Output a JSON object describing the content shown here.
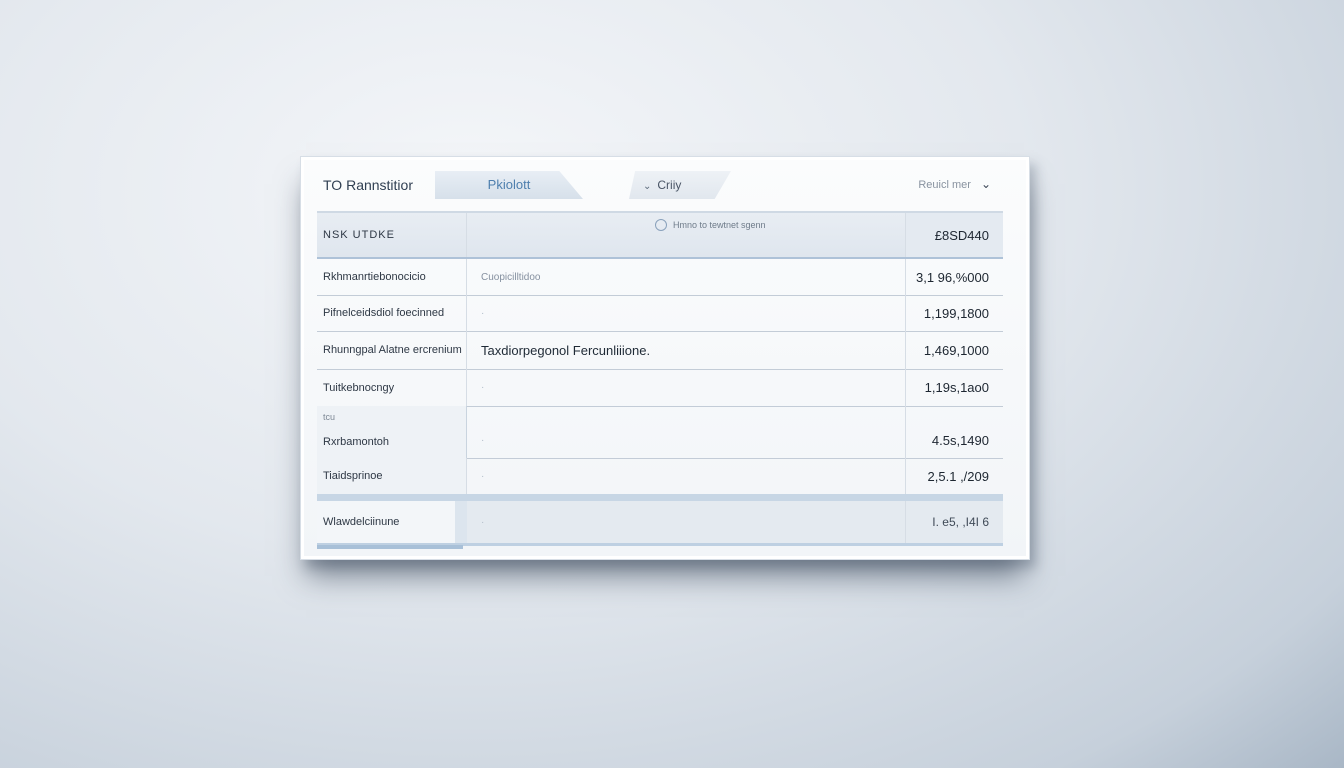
{
  "topbar": {
    "app_title": "TO Rannstitior",
    "tab_active": "Pkiolott",
    "filter_label": "Criiy",
    "report_select": "Reuicl mer"
  },
  "table": {
    "header": {
      "col1": "NSK UTDKE",
      "col2": "Hmno to tewtnet sgenn",
      "col3": "£8SD440"
    },
    "rows": [
      {
        "name": "Rkhmanrtiebonocicio",
        "detail": "Cuopicilltidoo",
        "value": "3,1 96,%000"
      },
      {
        "name": "Pifnelceidsdiol foecinned",
        "detail": "",
        "value": "1,199,1800"
      },
      {
        "name": "Rhunngpal Alatne ercrenium",
        "detail": "Taxdiorpegonol Fercunliiione.",
        "value": "1,469,1000"
      },
      {
        "name": "Tuitkebnocngy",
        "detail": "",
        "value": "1,19s,1ao0"
      },
      {
        "name": "Rxrbamontoh",
        "mini": "tcu",
        "detail": "",
        "value": "4.5s,1490"
      },
      {
        "name": "Tiaidsprinoe",
        "detail": "",
        "value": "2,5.1 ,/209"
      },
      {
        "name": "Wlawdelciinune",
        "detail": "",
        "value": "I. e5, ,I4I 6"
      }
    ]
  }
}
